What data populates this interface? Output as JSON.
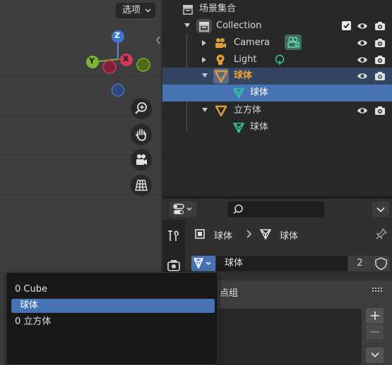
{
  "viewport": {
    "options_label": "选项",
    "gizmo": {
      "z": "Z",
      "y": "Y",
      "x": "X"
    }
  },
  "outliner": {
    "scene_collection": "场景集合",
    "collection": "Collection",
    "camera": "Camera",
    "light": "Light",
    "sphere": "球体",
    "sphere_mesh": "球体",
    "cube": "立方体",
    "cube_mesh": "球体"
  },
  "properties": {
    "breadcrumb_object": "球体",
    "breadcrumb_mesh": "球体",
    "datablock_name": "球体",
    "users_count": "2",
    "panel_title_partial": "点组"
  },
  "popup": {
    "items": [
      "0 Cube",
      "球体",
      "0 立方体"
    ],
    "selected_index": 1
  },
  "colors": {
    "selection_blue": "#4772b3",
    "active_row": "#334561",
    "object_orange": "#e09a3c",
    "mesh_teal": "#2ec8a6",
    "camera_green": "#5fae78"
  }
}
